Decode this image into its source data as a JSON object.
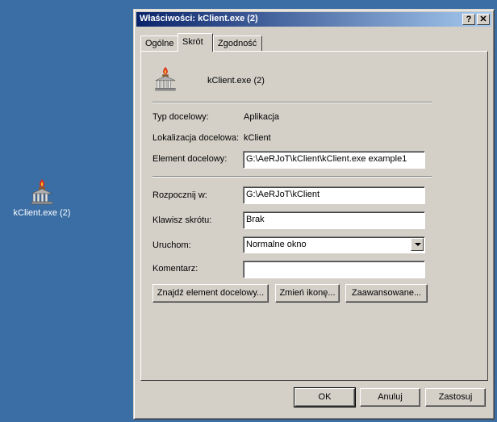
{
  "desktop": {
    "icon_label": "kClient.exe (2)"
  },
  "window": {
    "title": "Właściwości: kClient.exe (2)",
    "help_label": "?",
    "close_label": "✕"
  },
  "tabs": [
    {
      "label": "Ogólne",
      "active": false
    },
    {
      "label": "Skrót",
      "active": true
    },
    {
      "label": "Zgodność",
      "active": false
    }
  ],
  "shortcut": {
    "name": "kClient.exe (2)",
    "target_type_label": "Typ docelowy:",
    "target_type_value": "Aplikacja",
    "target_location_label": "Lokalizacja docelowa:",
    "target_location_value": "kClient",
    "target_label": "Element docelowy:",
    "target_value": "G:\\AeRJoT\\kClient\\kClient.exe example1",
    "start_in_label": "Rozpocznij w:",
    "start_in_value": "G:\\AeRJoT\\kClient",
    "hotkey_label": "Klawisz skrótu:",
    "hotkey_value": "Brak",
    "run_label": "Uruchom:",
    "run_value": "Normalne okno",
    "comment_label": "Komentarz:",
    "comment_value": ""
  },
  "buttons": {
    "find_target": "Znajdź element docelowy...",
    "change_icon": "Zmień ikonę...",
    "advanced": "Zaawansowane...",
    "ok": "OK",
    "cancel": "Anuluj",
    "apply": "Zastosuj"
  }
}
